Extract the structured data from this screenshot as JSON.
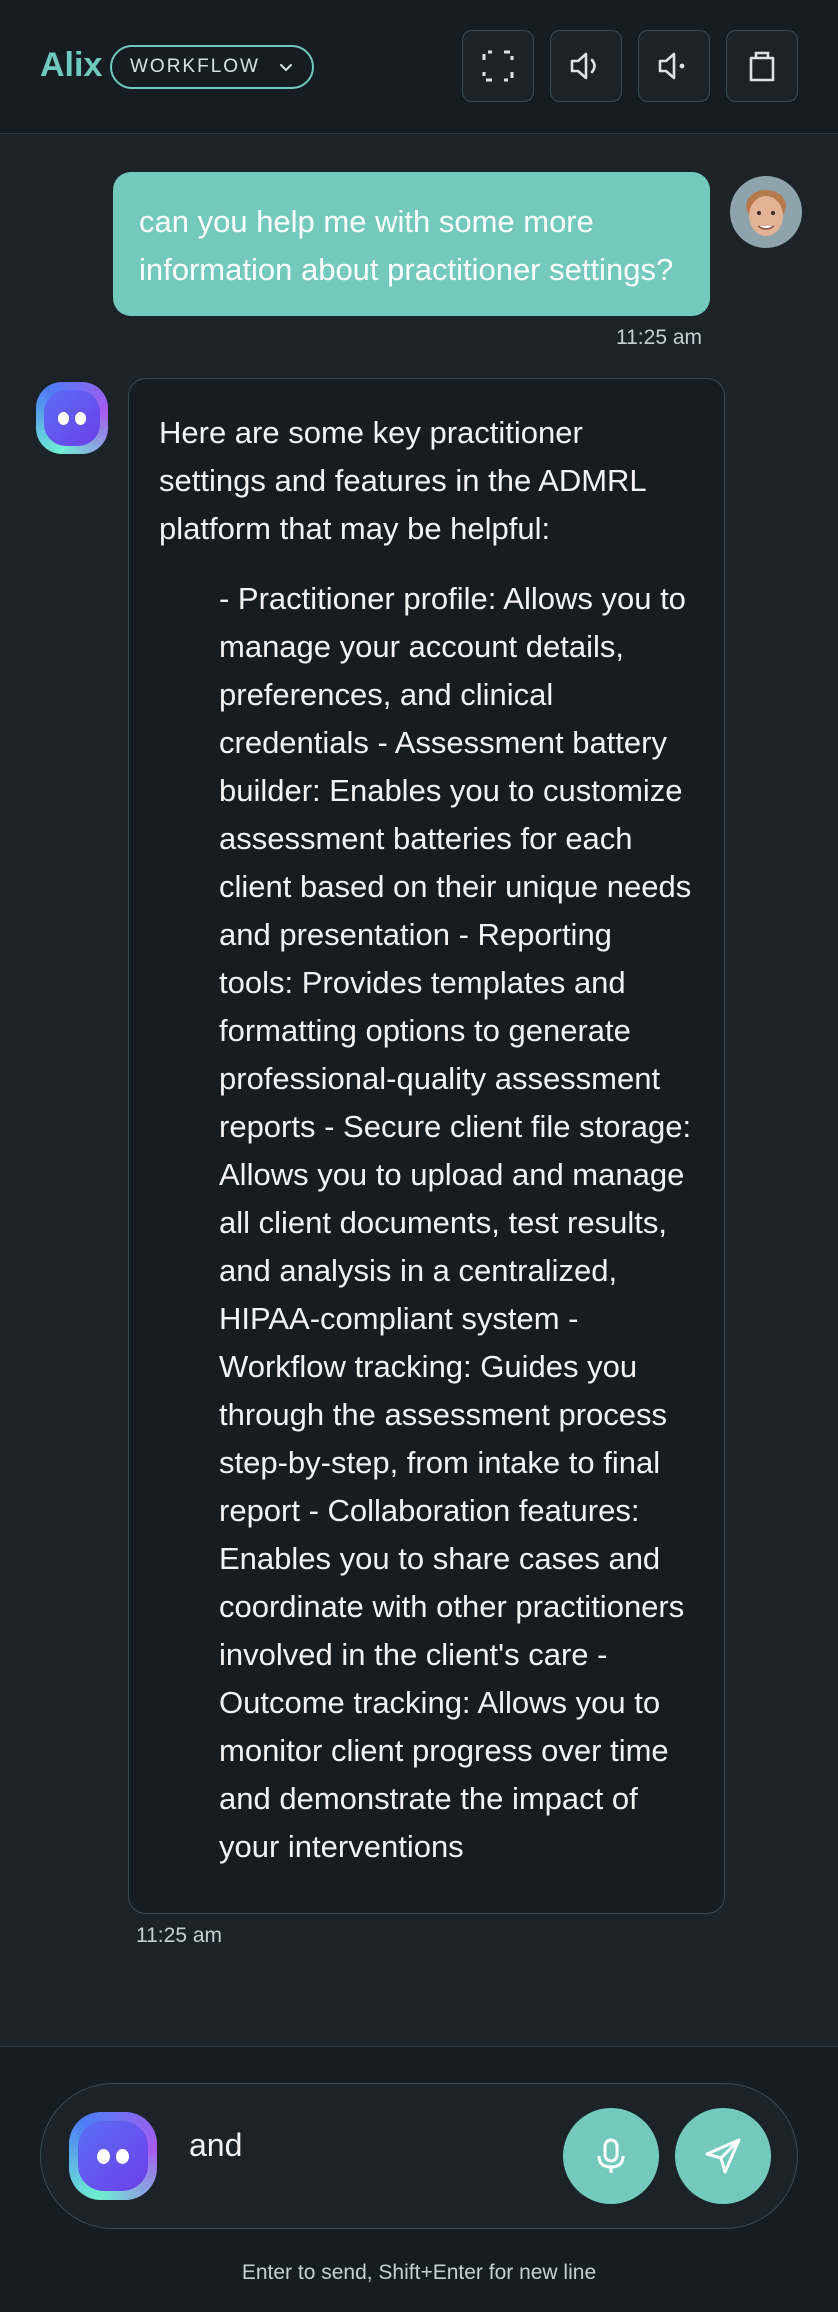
{
  "header": {
    "brand": "Alix",
    "mode_label": "WORKFLOW",
    "buttons": [
      {
        "name": "fullscreen-icon"
      },
      {
        "name": "volume-up-icon"
      },
      {
        "name": "volume-low-icon"
      },
      {
        "name": "bag-icon"
      }
    ],
    "accent_color": "#6fcabd"
  },
  "messages": {
    "user": {
      "text": "can you help me with some more information about practitioner settings?",
      "time": "11:25 am"
    },
    "bot": {
      "intro": "Here are some key practitioner settings and features in the ADMRL platform that may be helpful:",
      "detail": "- Practitioner profile: Allows you to manage your account details, preferences, and clinical credentials - Assessment battery builder: Enables you to customize assessment batteries for each client based on their unique needs and presentation - Reporting tools: Provides templates and formatting options to generate professional-quality assessment reports - Secure client file storage: Allows you to upload and manage all client documents, test results, and analysis in a centralized, HIPAA-compliant system - Workflow tracking: Guides you through the assessment process step-by-step, from intake to final report - Collaboration features: Enables you to share cases and coordinate with other practitioners involved in the client's care - Outcome tracking: Allows you to monitor client progress over time and demonstrate the impact of your interventions",
      "time": "11:25 am"
    }
  },
  "composer": {
    "value": "and",
    "hint": "Enter to send, Shift+Enter for new line"
  }
}
